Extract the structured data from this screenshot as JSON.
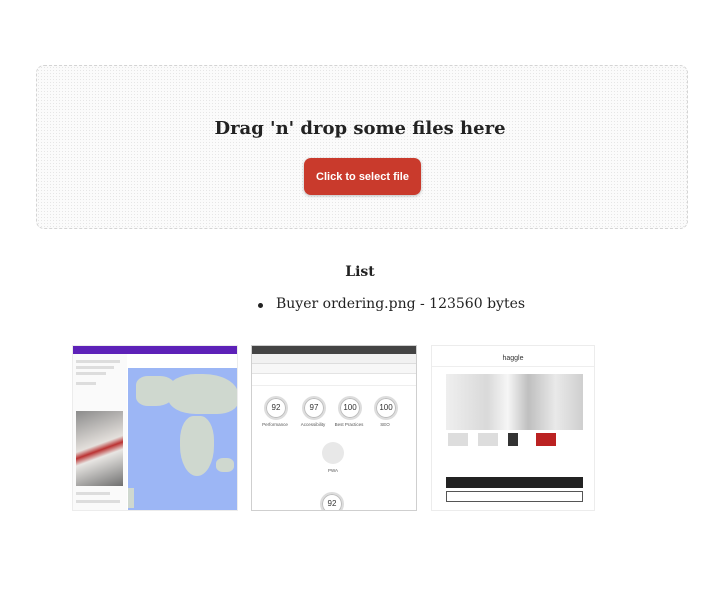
{
  "dropzone": {
    "title": "Drag 'n' drop some files here",
    "button_label": "Click to select file"
  },
  "list": {
    "heading": "List",
    "items": [
      "Buyer ordering.png - 123560 bytes"
    ]
  },
  "thumbnails": [
    {
      "name": "thumbnail-map-app"
    },
    {
      "name": "thumbnail-lighthouse-report",
      "scores": [
        {
          "label": "Performance",
          "value": "92"
        },
        {
          "label": "Accessibility",
          "value": "97"
        },
        {
          "label": "Best Practices",
          "value": "100"
        },
        {
          "label": "SEO",
          "value": "100"
        }
      ],
      "pwa_label": "PWA",
      "bottom_score": "92"
    },
    {
      "name": "thumbnail-shop-product",
      "header": "haggle"
    }
  ],
  "colors": {
    "button": "#c93a2c",
    "app_bar": "#5d21b8"
  }
}
